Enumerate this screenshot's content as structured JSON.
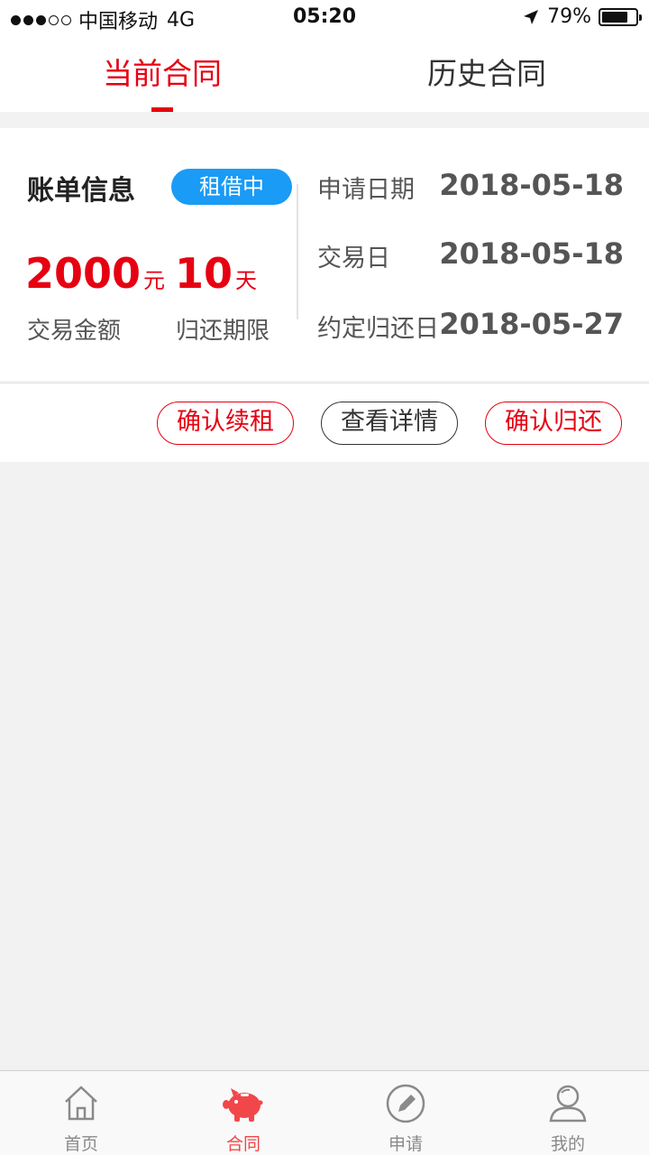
{
  "status_bar": {
    "carrier": "中国移动",
    "network": "4G",
    "time": "05:20",
    "battery": "79%",
    "battery_level": 0.79
  },
  "tabs": [
    {
      "label": "当前合同",
      "active": true
    },
    {
      "label": "历史合同",
      "active": false
    }
  ],
  "bill": {
    "title": "账单信息",
    "status": "租借中",
    "amount": "2000",
    "amount_unit": "元",
    "amount_label": "交易金额",
    "term": "10",
    "term_unit": "天",
    "term_label": "归还期限",
    "info": [
      {
        "key": "申请日期",
        "value": "2018-05-18"
      },
      {
        "key": "交易日",
        "value": "2018-05-18"
      },
      {
        "key": "约定归还日",
        "value": "2018-05-27"
      }
    ]
  },
  "actions": {
    "renew": "确认续租",
    "details": "查看详情",
    "return": "确认归还"
  },
  "bottom_nav": [
    {
      "label": "首页",
      "icon": "home-icon",
      "active": false
    },
    {
      "label": "合同",
      "icon": "piggy-bank-icon",
      "active": true
    },
    {
      "label": "申请",
      "icon": "pencil-icon",
      "active": false
    },
    {
      "label": "我的",
      "icon": "user-icon",
      "active": false
    }
  ],
  "colors": {
    "accent": "#e60012",
    "badge": "#1a9bf5",
    "nav_active": "#f2474a",
    "nav_inactive": "#8a8a8a"
  }
}
